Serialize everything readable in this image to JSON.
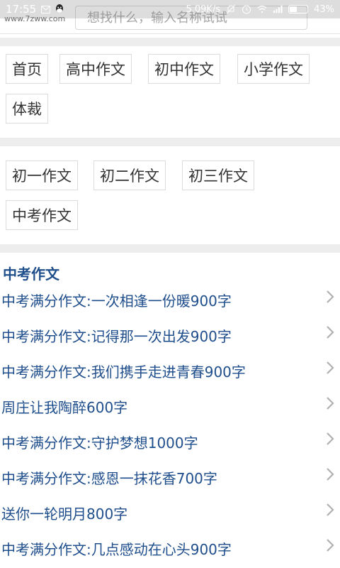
{
  "status": {
    "time": "17:55",
    "speed": "5.09K/s",
    "battery": "43%",
    "battery_level": 0.43,
    "icons": [
      "message-icon",
      "qq-icon",
      "mute-icon",
      "alarm-icon",
      "wifi-icon",
      "signal-icon"
    ]
  },
  "header": {
    "logo_text": "www.7zww.com",
    "search_placeholder": "想找什么，输入名称试试"
  },
  "categories": [
    {
      "label": "首页"
    },
    {
      "label": "高中作文"
    },
    {
      "label": "初中作文"
    },
    {
      "label": "小学作文"
    },
    {
      "label": "体裁"
    }
  ],
  "subcategories": [
    {
      "label": "初一作文"
    },
    {
      "label": "初二作文"
    },
    {
      "label": "初三作文"
    },
    {
      "label": "中考作文"
    }
  ],
  "list": {
    "title": "中考作文",
    "items": [
      {
        "text": "中考满分作文:一次相逢一份暖900字"
      },
      {
        "text": "中考满分作文:记得那一次出发900字"
      },
      {
        "text": "中考满分作文:我们携手走进青春900字"
      },
      {
        "text": "周庄让我陶醉600字"
      },
      {
        "text": "中考满分作文:守护梦想1000字"
      },
      {
        "text": "中考满分作文:感恩一抹花香700字"
      },
      {
        "text": "送你一轮明月800字"
      },
      {
        "text": "中考满分作文:几点感动在心头900字"
      }
    ]
  },
  "colors": {
    "link": "#1f4e8c",
    "tag_text": "#333333",
    "divider": "#ededed"
  }
}
